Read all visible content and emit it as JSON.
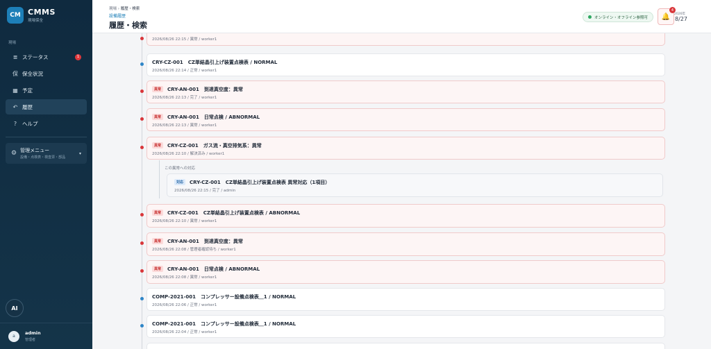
{
  "app": {
    "logo": "CM",
    "title": "CMMS",
    "subtitle": "現場保全"
  },
  "sidebar": {
    "section": "現場",
    "items": [
      {
        "label": "ステータス",
        "icon": "≣",
        "badge": "1"
      },
      {
        "label": "保全状況",
        "icon": "保"
      },
      {
        "label": "予定",
        "icon": "▦"
      },
      {
        "label": "履歴",
        "icon": "↶"
      },
      {
        "label": "ヘルプ",
        "icon": "?"
      }
    ],
    "admin_menu": {
      "title": "管理メニュー",
      "subtitle": "設備・点検表・検査票・部品",
      "icon": "⚙",
      "caret": "▾"
    },
    "ai_label": "AI",
    "user": {
      "avatar": "a",
      "name": "admin",
      "role": "管理者"
    }
  },
  "header": {
    "breadcrumb": {
      "root": "現場",
      "sep": "›",
      "current": "履歴・検索"
    },
    "subtitle": "設備履歴",
    "title": "履歴・検索",
    "online_status": "オンライン・オフライン参照可",
    "notif_count": "4",
    "bell_icon": "🔔",
    "date_year": "2026年",
    "date_day": "8/27"
  },
  "timeline": {
    "top_partial_meta": "2026/08/26 22:15 / 異常 / worker1",
    "records": [
      {
        "title": "CRY-CZ-001　CZ単結晶引上げ装置点検表 / NORMAL",
        "meta": "2026/08/26 22:14 / 正常 / worker1"
      },
      {
        "tag": "異常",
        "title": "CRY-AN-001　到達真空度：異常",
        "meta": "2026/08/26 22:13 / 完了 / worker1"
      },
      {
        "tag": "異常",
        "title": "CRY-AN-001　日常点検 / ABNORMAL",
        "meta": "2026/08/26 22:13 / 異常 / worker1"
      },
      {
        "tag": "異常",
        "title": "CRY-CZ-001　ガス流・真空排気系：異常",
        "meta": "2026/08/26 22:10 / 解決済み / worker1"
      },
      {
        "tag": "異常",
        "title": "CRY-CZ-001　CZ単結晶引上げ装置点検表 / ABNORMAL",
        "meta": "2026/08/26 22:10 / 異常 / worker1"
      },
      {
        "tag": "異常",
        "title": "CRY-AN-001　到達真空度：異常",
        "meta": "2026/08/26 22:08 / 管理者確認待ち / worker1"
      },
      {
        "tag": "異常",
        "title": "CRY-AN-001　日常点検 / ABNORMAL",
        "meta": "2026/08/26 22:08 / 異常 / worker1"
      },
      {
        "title": "COMP-2021-001　コンプレッサー設備点検表＿1 / NORMAL",
        "meta": "2026/08/26 22:06 / 正常 / worker1"
      },
      {
        "title": "COMP-2021-001　コンプレッサー設備点検表＿1 / NORMAL",
        "meta": "2026/08/26 22:04 / 正常 / worker1"
      }
    ],
    "response": {
      "label": "この異常への対応",
      "tag": "対応",
      "title": "CRY-CZ-001　CZ単結晶引上げ装置点検表 異常対応（1項目）",
      "meta": "2026/08/26 22:15 / 完了 / admin"
    }
  },
  "colors": {
    "sidebar_bg": "#0f2a3f",
    "accent": "#1d7fb8",
    "abnormal": "#d9363a",
    "normal_dot": "#2f86c7"
  }
}
